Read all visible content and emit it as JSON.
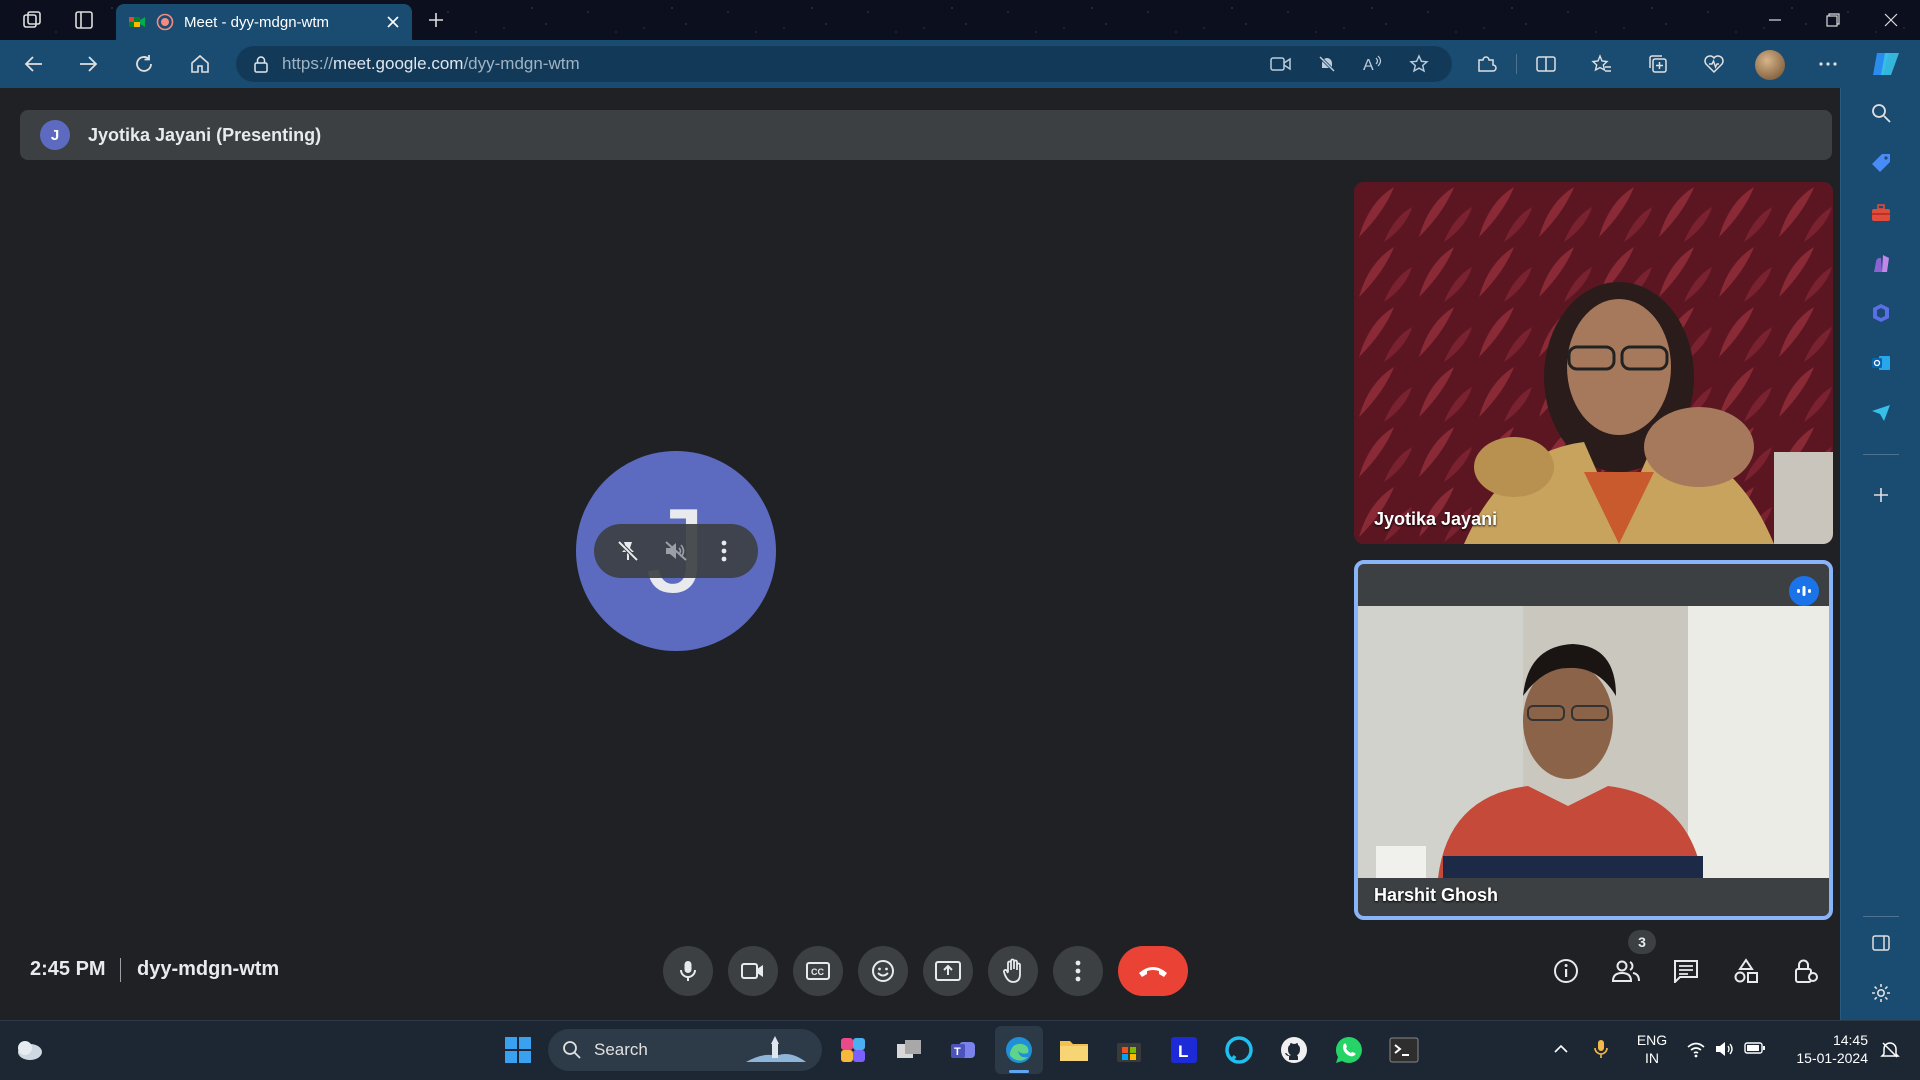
{
  "browser": {
    "tab_title": "Meet - dyy-mdgn-wtm",
    "url_prefix": "https://",
    "url_host": "meet.google.com",
    "url_path": "/dyy-mdgn-wtm",
    "accent": "#1a4b70"
  },
  "meet": {
    "presenting_initial": "J",
    "presenting_label": "Jyotika Jayani (Presenting)",
    "main_tile_initial": "J",
    "participants": [
      {
        "name": "Jyotika Jayani"
      },
      {
        "name": "Harshit Ghosh",
        "speaking": true
      }
    ],
    "time": "2:45 PM",
    "meeting_code": "dyy-mdgn-wtm",
    "participant_count": "3",
    "controls": [
      "microphone-icon",
      "camera-icon",
      "captions-icon",
      "emoji-icon",
      "present-icon",
      "raise-hand-icon",
      "more-icon"
    ],
    "right_controls": [
      "info-icon",
      "people-icon",
      "chat-icon",
      "activities-icon",
      "host-controls-icon"
    ],
    "end_call_color": "#ea4335",
    "avatar_color": "#5c6bc0"
  },
  "taskbar": {
    "search_placeholder": "Search",
    "lang_top": "ENG",
    "lang_bottom": "IN",
    "time": "14:45",
    "date": "15-01-2024"
  }
}
